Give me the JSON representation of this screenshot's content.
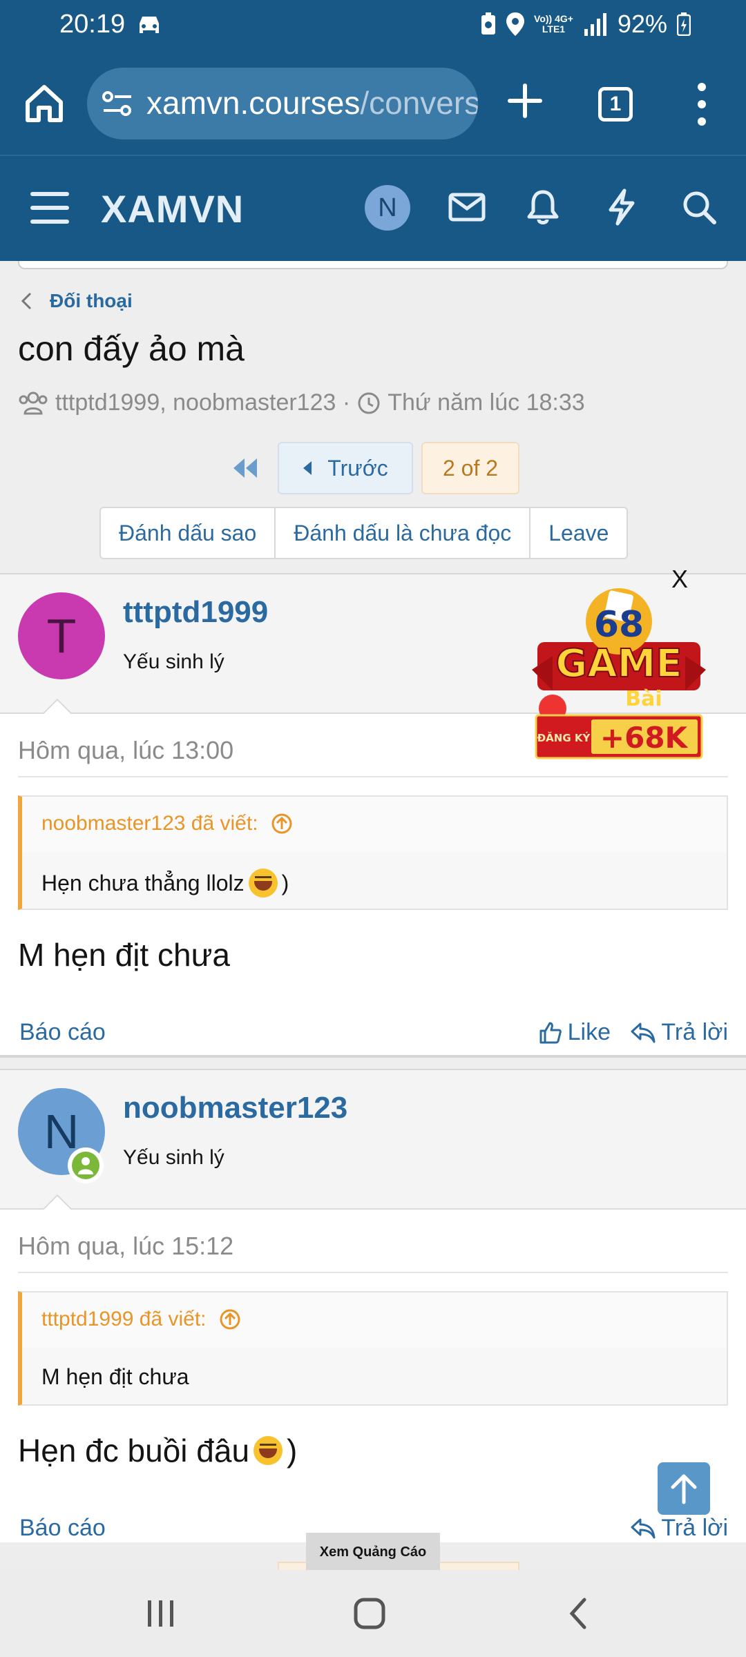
{
  "status_bar": {
    "time": "20:19",
    "battery": "92%",
    "network_top": "Vo)) 4G+",
    "network_bottom": "LTE1",
    "icons": [
      "car-icon",
      "battery-saver-icon",
      "location-icon",
      "signal-icon",
      "battery-icon"
    ]
  },
  "browser": {
    "url_host": "xamvn.courses",
    "url_path": "/conversations",
    "tab_count": "1"
  },
  "site": {
    "logo": "XAMVN",
    "user_initial": "N"
  },
  "breadcrumb": {
    "label": "Đối thoại"
  },
  "conversation": {
    "title": "con đấy ảo mà",
    "participants": "tttptd1999, noobmaster123 ·",
    "time": "Thứ năm lúc 18:33"
  },
  "pagination": {
    "prev_label": "Trước",
    "current": "2 of 2"
  },
  "actions": [
    "Đánh dấu sao",
    "Đánh dấu là chưa đọc",
    "Leave"
  ],
  "messages": [
    {
      "initial": "T",
      "avatar_color": "#c93ab1",
      "username": "tttptd1999",
      "user_title": "Yếu sinh lý",
      "date": "Hôm qua, lúc 13:00",
      "quote_author": "noobmaster123 đã viết:",
      "quote_text": "Hẹn chưa thẳng llolz",
      "quote_suffix": ")",
      "text": "M hẹn địt chưa",
      "text_suffix": "",
      "report": "Báo cáo",
      "like": "Like",
      "reply": "Trả lời"
    },
    {
      "initial": "N",
      "avatar_color": "#6b9fd4",
      "username": "noobmaster123",
      "user_title": "Yếu sinh lý",
      "date": "Hôm qua, lúc 15:12",
      "quote_author": "tttptd1999 đã viết:",
      "quote_text": "M hẹn địt chưa",
      "quote_suffix": "",
      "text": "Hẹn đc buồi đâu",
      "text_suffix": ")",
      "report": "Báo cáo",
      "reply": "Trả lời"
    }
  ],
  "ad": {
    "close": "X",
    "brand": "68",
    "line1": "GAME",
    "line2": "Bài",
    "cta": "ĐĂNG KÝ",
    "bonus": "+68K",
    "tab": "Xem Quảng Cáo"
  },
  "colors": {
    "header": "#185886",
    "link": "#2a6aa0",
    "quote_accent": "#f0a63a",
    "online": "#7bb83a"
  }
}
